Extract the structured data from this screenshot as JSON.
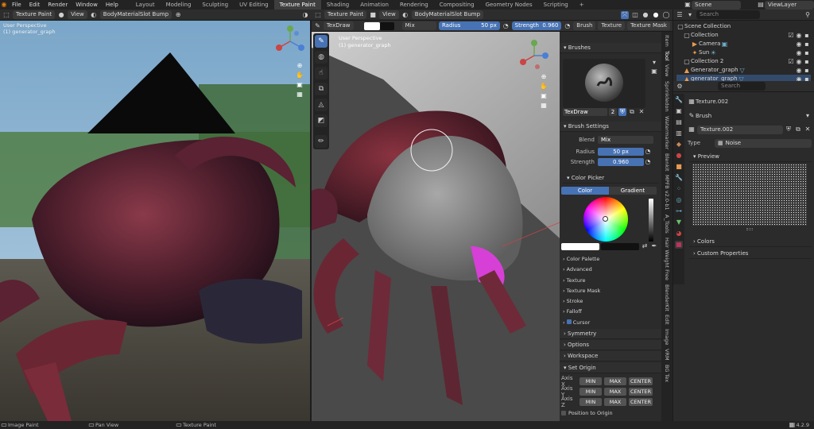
{
  "menu": [
    "File",
    "Edit",
    "Render",
    "Window",
    "Help"
  ],
  "workspaces": [
    "Layout",
    "Modeling",
    "Sculpting",
    "UV Editing",
    "Texture Paint",
    "Shading",
    "Animation",
    "Rendering",
    "Compositing",
    "Geometry Nodes",
    "Scripting",
    "+"
  ],
  "scene_label": "Scene",
  "viewlayer_label": "ViewLayer",
  "left_header": {
    "mode": "Texture Paint",
    "view": "View",
    "slot": "BodyMaterialSlot Bump"
  },
  "left_overlay": {
    "line1": "User Perspective",
    "line2": "(1) generator_graph"
  },
  "mid_header": {
    "mode": "Texture Paint",
    "view": "View",
    "slot": "BodyMaterialSlot Bump"
  },
  "tool_header": {
    "brush": "TexDraw",
    "blend": "Mix",
    "radius_label": "Radius",
    "radius_value": "50 px",
    "strength_label": "Strength",
    "strength_value": "0.960",
    "brush_menu": "Brush",
    "texture_menu": "Texture",
    "texture_mask_menu": "Texture Mask"
  },
  "mid_overlay": {
    "line1": "User Perspective",
    "line2": "(1) generator_graph"
  },
  "npanel": {
    "brushes_title": "Brushes",
    "brush_name": "TexDraw",
    "brush_users": "2",
    "brush_settings_title": "Brush Settings",
    "blend_label": "Blend",
    "blend_value": "Mix",
    "radius_label": "Radius",
    "radius_value": "50 px",
    "strength_label": "Strength",
    "strength_value": "0.960",
    "color_picker_title": "Color Picker",
    "color_tab": "Color",
    "gradient_tab": "Gradient",
    "subpanels": [
      "Color Palette",
      "Advanced",
      "Texture",
      "Texture Mask",
      "Stroke",
      "Falloff"
    ],
    "cursor_label": "Cursor",
    "symmetry": "Symmetry",
    "options": "Options",
    "workspace": "Workspace",
    "set_origin": "Set Origin",
    "axes": [
      "Axis X",
      "Axis Y",
      "Axis Z"
    ],
    "min": "MIN",
    "max": "MAX",
    "center": "CENTER",
    "position_to_origin": "Position to Origin"
  },
  "vtabs": [
    "Item",
    "Tool",
    "View",
    "Sprinkledon",
    "Watermarker",
    "Blenkit",
    "MPFB v2.0-b1",
    "A_Tools",
    "Hair Weight Free",
    "BlenderKit",
    "Edit",
    "Image",
    "VRM",
    "BG Tex"
  ],
  "outliner": {
    "search_placeholder": "Search",
    "rows": [
      "Scene Collection",
      "Collection",
      "Camera",
      "Sun",
      "Collection 2",
      "Generator_graph",
      "generator_graph"
    ]
  },
  "properties": {
    "search_placeholder": "Search",
    "texture_name": "Texture.002",
    "brush_label": "Brush",
    "texture_field": "Texture.002",
    "type_label": "Type",
    "type_value": "Noise",
    "preview": "Preview",
    "colors": "Colors",
    "custom_props": "Custom Properties"
  },
  "status": {
    "left": "Image Paint",
    "mid": "Pan View",
    "right": "Texture Paint",
    "version": "4.2.9"
  },
  "colors": {
    "accent": "#4772b3",
    "bg": "#1d1d1d",
    "panel": "#2b2b2b"
  }
}
